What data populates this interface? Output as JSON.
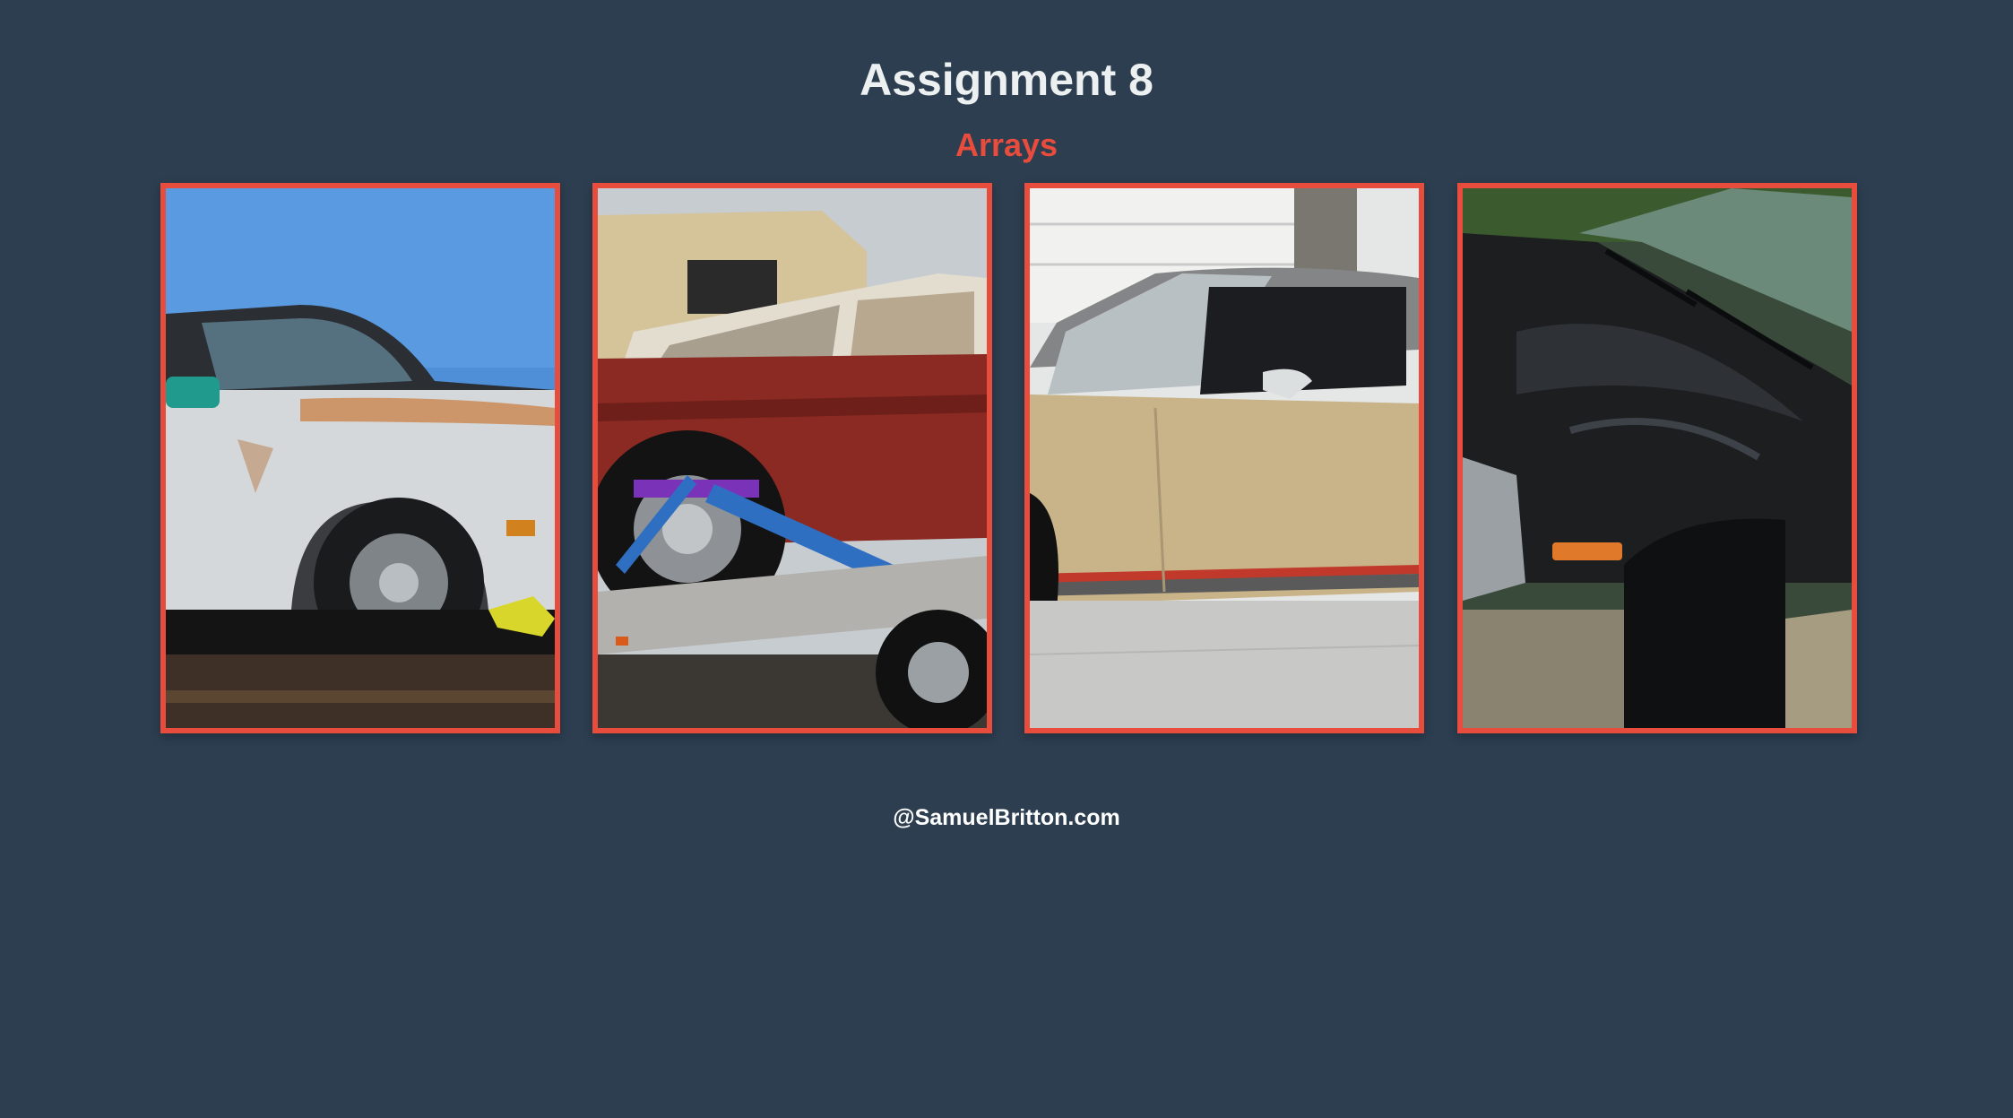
{
  "header": {
    "title": "Assignment 8",
    "subtitle": "Arrays"
  },
  "gallery": {
    "images": [
      {
        "subject": "white car on trailer",
        "body_color": "#d4d8da",
        "accent": "#c97a3a"
      },
      {
        "subject": "red car strapped to trailer",
        "body_color": "#8b2a22",
        "accent": "#2f6fc2"
      },
      {
        "subject": "tan car in driveway",
        "body_color": "#c9b48a",
        "accent": "#c0392b"
      },
      {
        "subject": "black car front fender",
        "body_color": "#1c1e20",
        "accent": "#e07a2a"
      }
    ]
  },
  "footer": {
    "text": "@SamuelBritton.com"
  },
  "colors": {
    "background": "#2c3e50",
    "accent": "#e74c3c",
    "title": "#ecf0f1"
  }
}
